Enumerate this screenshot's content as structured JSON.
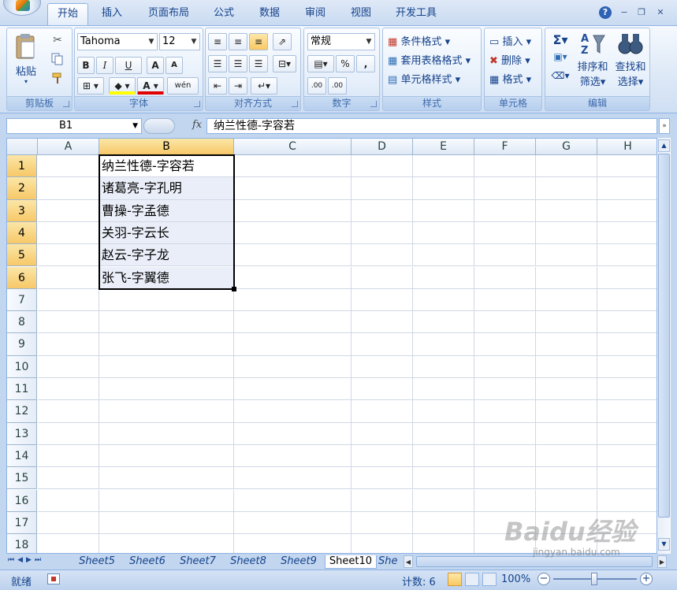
{
  "tabs": [
    "开始",
    "插入",
    "页面布局",
    "公式",
    "数据",
    "审阅",
    "视图",
    "开发工具"
  ],
  "active_tab": "开始",
  "ribbon": {
    "clipboard": {
      "label": "剪贴板",
      "paste": "粘贴"
    },
    "font": {
      "label": "字体",
      "family": "Tahoma",
      "size": "12",
      "bold": "B",
      "italic": "I",
      "underline": "U",
      "grow": "A",
      "shrink": "A",
      "font_color": "A",
      "phonetic": "wén"
    },
    "alignment": {
      "label": "对齐方式"
    },
    "number": {
      "label": "数字",
      "format": "常规",
      "percent": "%",
      "comma": ",",
      "inc_decimal": ".00",
      "dec_decimal": ".00"
    },
    "styles": {
      "label": "样式",
      "conditional": "条件格式",
      "table": "套用表格格式",
      "cell_styles": "单元格样式"
    },
    "cells": {
      "label": "单元格",
      "insert": "插入",
      "delete": "删除",
      "format": "格式"
    },
    "editing": {
      "label": "编辑",
      "sigma": "Σ",
      "sort": "排序和",
      "sort2": "筛选",
      "find": "查找和",
      "find2": "选择"
    }
  },
  "formula_bar": {
    "name_box": "B1",
    "fx": "fx",
    "content": "纳兰性德-字容若"
  },
  "columns": [
    "A",
    "B",
    "C",
    "D",
    "E",
    "F",
    "G",
    "H"
  ],
  "selected_column": "B",
  "rows": [
    "1",
    "2",
    "3",
    "4",
    "5",
    "6",
    "7",
    "8",
    "9",
    "10",
    "11",
    "12",
    "13",
    "14",
    "15",
    "16",
    "17",
    "18"
  ],
  "cells_b": [
    "纳兰性德-字容若",
    "诸葛亮-字孔明",
    "曹操-字孟德",
    "关羽-字云长",
    "赵云-字子龙",
    "张飞-字翼德"
  ],
  "sheets": [
    "Sheet5",
    "Sheet6",
    "Sheet7",
    "Sheet8",
    "Sheet9",
    "Sheet10",
    "She"
  ],
  "active_sheet": "Sheet10",
  "status": {
    "ready": "就绪",
    "count": "计数: 6",
    "zoom": "100%",
    "minus": "−",
    "plus": "+"
  },
  "watermark": {
    "brand": "Baidu经验",
    "url": "jingyan.baidu.com"
  }
}
